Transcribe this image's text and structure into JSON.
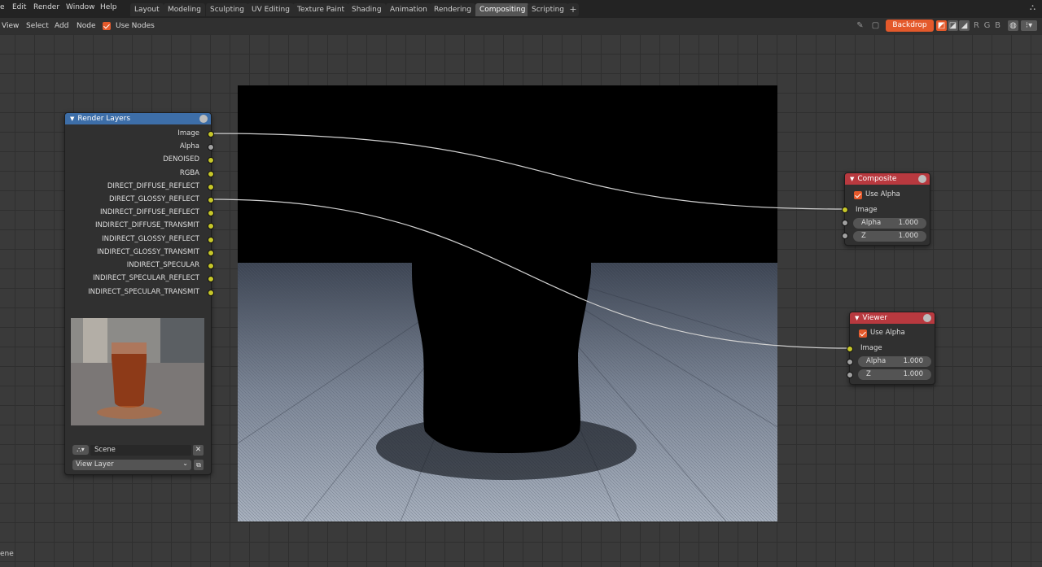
{
  "menubar": {
    "items": [
      "e",
      "Edit",
      "Render",
      "Window",
      "Help"
    ],
    "workspaces": [
      "Layout",
      "Modeling",
      "Sculpting",
      "UV Editing",
      "Texture Paint",
      "Shading",
      "Animation",
      "Rendering",
      "Compositing",
      "Scripting"
    ],
    "active_workspace": "Compositing",
    "add_tab": "+"
  },
  "header": {
    "menus": [
      "View",
      "Select",
      "Add",
      "Node"
    ],
    "use_nodes_label": "Use Nodes",
    "use_nodes_checked": true,
    "backdrop_label": "Backdrop",
    "channel_labels": [
      "R",
      "G",
      "B"
    ]
  },
  "render_layers": {
    "title": "Render Layers",
    "outputs": [
      "Image",
      "Alpha",
      "DENOISED",
      "RGBA",
      "DIRECT_DIFFUSE_REFLECT",
      "DIRECT_GLOSSY_REFLECT",
      "INDIRECT_DIFFUSE_REFLECT",
      "INDIRECT_DIFFUSE_TRANSMIT",
      "INDIRECT_GLOSSY_REFLECT",
      "INDIRECT_GLOSSY_TRANSMIT",
      "INDIRECT_SPECULAR",
      "INDIRECT_SPECULAR_REFLECT",
      "INDIRECT_SPECULAR_TRANSMIT"
    ],
    "scene_label": "Scene",
    "view_layer_label": "View Layer"
  },
  "composite": {
    "title": "Composite",
    "use_alpha_label": "Use Alpha",
    "image_label": "Image",
    "alpha_label": "Alpha",
    "alpha_value": "1.000",
    "z_label": "Z",
    "z_value": "1.000"
  },
  "viewer": {
    "title": "Viewer",
    "use_alpha_label": "Use Alpha",
    "image_label": "Image",
    "alpha_label": "Alpha",
    "alpha_value": "1.000",
    "z_label": "Z",
    "z_value": "1.000"
  },
  "statusbar": {
    "text": "ene"
  },
  "colors": {
    "accent": "#e4592b",
    "render_layers_header": "#3d6ea8",
    "output_node_header": "#b8393f",
    "socket_color": "#c7c729",
    "socket_value": "#a1a1a1"
  },
  "icons": [
    "pin-icon",
    "backdrop-fit-icon",
    "overlay-icon",
    "gizmo-icon",
    "globe-icon",
    "scene-icon",
    "close-icon",
    "new-icon"
  ]
}
